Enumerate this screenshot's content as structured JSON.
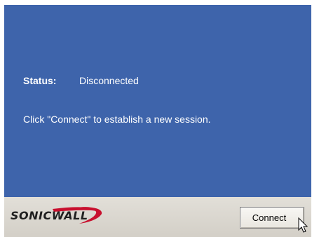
{
  "status": {
    "label": "Status:",
    "value": "Disconnected"
  },
  "message": "Click \"Connect\" to establish a new session.",
  "footer": {
    "logo_text": "SONICWALL",
    "connect_label": "Connect"
  },
  "icons": {
    "logo": "sonicwall-logo-swoosh",
    "cursor": "mouse-pointer-icon"
  },
  "colors": {
    "panel_background": "#3e64ab",
    "panel_text": "#ffffff",
    "footer_background": "#d8d4cc",
    "logo_swoosh": "#c8102e"
  }
}
